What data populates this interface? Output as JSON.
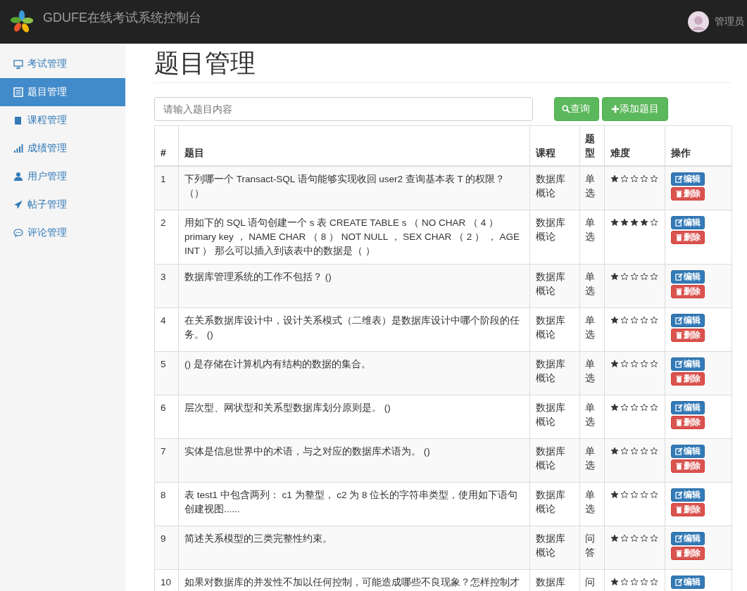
{
  "navbar": {
    "brand": "GDUFE在线考试系统控制台",
    "user": "管理员"
  },
  "sidebar": {
    "items": [
      {
        "label": "考试管理",
        "selected": false
      },
      {
        "label": "题目管理",
        "selected": true
      },
      {
        "label": "课程管理",
        "selected": false
      },
      {
        "label": "成绩管理",
        "selected": false
      },
      {
        "label": "用户管理",
        "selected": false
      },
      {
        "label": "帖子管理",
        "selected": false
      },
      {
        "label": "评论管理",
        "selected": false
      }
    ]
  },
  "page_title": "题目管理",
  "search": {
    "placeholder": "请输入题目内容",
    "button": "查询",
    "add_button": "添加题目"
  },
  "table": {
    "columns": [
      "#",
      "题目",
      "课程",
      "题型",
      "难度",
      "操作"
    ],
    "rows": [
      {
        "no": "1",
        "question": "下列哪一个 Transact-SQL 语句能够实现收回 user2 查询基本表 T 的权限？（）",
        "course": "数据库概论",
        "type": "单选",
        "stars": 1,
        "edit": "编辑",
        "delete": "删除"
      },
      {
        "no": "2",
        "question": "用如下的 SQL 语句创建一个 s 表 CREATE  TABLE  s  （ NO  CHAR  （ 4 ） primary key ，  NAME  CHAR  （ 8 ）  NOT  NULL ，  SEX  CHAR  （ 2 ） ，  AGE  INT ）  那么可以插入到该表中的数据是（ ）",
        "course": "数据库概论",
        "type": "单选",
        "stars": 4,
        "edit": "编辑",
        "delete": "删除"
      },
      {
        "no": "3",
        "question": "数据库管理系统的工作不包括？  ()",
        "course": "数据库概论",
        "type": "单选",
        "stars": 1,
        "edit": "编辑",
        "delete": "删除"
      },
      {
        "no": "4",
        "question": "在关系数据库设计中，设计关系模式（二维表）是数据库设计中哪个阶段的任务。 ()",
        "course": "数据库概论",
        "type": "单选",
        "stars": 1,
        "edit": "编辑",
        "delete": "删除"
      },
      {
        "no": "5",
        "question": " ()  是存储在计算机内有结构的数据的集合。",
        "course": "数据库概论",
        "type": "单选",
        "stars": 1,
        "edit": "编辑",
        "delete": "删除"
      },
      {
        "no": "6",
        "question": "层次型、网状型和关系型数据库划分原则是。  ()",
        "course": "数据库概论",
        "type": "单选",
        "stars": 1,
        "edit": "编辑",
        "delete": "删除"
      },
      {
        "no": "7",
        "question": "实体是信息世界中的术语，与之对应的数据库术语为。  ()",
        "course": "数据库概论",
        "type": "单选",
        "stars": 1,
        "edit": "编辑",
        "delete": "删除"
      },
      {
        "no": "8",
        "question": "表 test1 中包含两列： c1 为整型， c2 为 8 位长的字符串类型，使用如下语句创建视图......",
        "course": "数据库概论",
        "type": "单选",
        "stars": 1,
        "edit": "编辑",
        "delete": "删除"
      },
      {
        "no": "9",
        "question": "简述关系模型的三类完整性约束。",
        "course": "数据库概论",
        "type": "问答",
        "stars": 1,
        "edit": "编辑",
        "delete": "删除"
      },
      {
        "no": "10",
        "question": "如果对数据库的并发性不加以任何控制，可能造成哪些不良现象？怎样控制才",
        "course": "数据库",
        "type": "问",
        "stars": 1,
        "edit": "编辑"
      }
    ]
  }
}
